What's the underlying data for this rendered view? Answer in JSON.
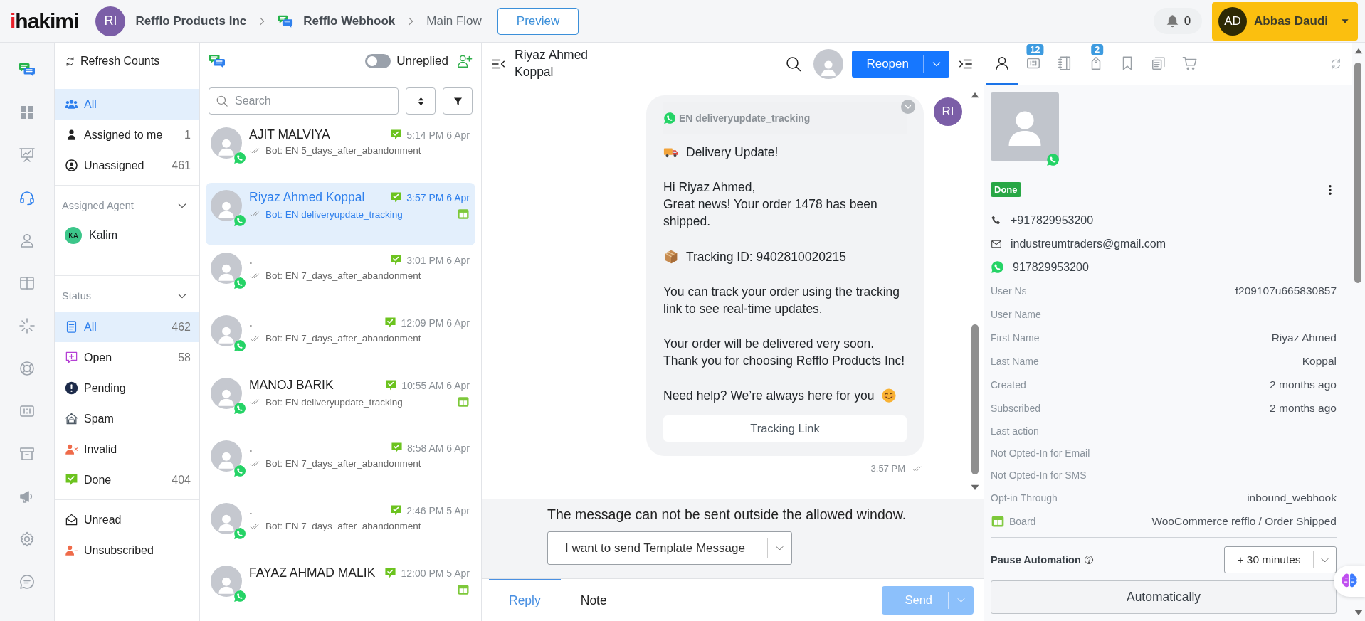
{
  "top_bar": {
    "logo": "ihakimi",
    "workspace": {
      "initials": "RI",
      "name": "Refflo Products Inc"
    },
    "bot": "Refflo Webhook",
    "flow": "Main Flow",
    "preview_button": "Preview",
    "notifications": "0",
    "user": {
      "initials": "AD",
      "name": "Abbas Daudi"
    }
  },
  "rail": [
    {
      "kind": "dashboard",
      "selected": false
    },
    {
      "kind": "analytics",
      "selected": false
    },
    {
      "kind": "inbox",
      "selected": true
    },
    {
      "kind": "contacts",
      "selected": false
    },
    {
      "kind": "columns",
      "selected": false
    },
    {
      "kind": "automation",
      "selected": false
    },
    {
      "kind": "support",
      "selected": false
    },
    {
      "kind": "kanban",
      "selected": false
    },
    {
      "kind": "archive",
      "selected": false
    },
    {
      "kind": "broadcast",
      "selected": false
    },
    {
      "kind": "settings",
      "selected": false
    },
    {
      "kind": "comments",
      "selected": false
    }
  ],
  "filters": {
    "refresh": "Refresh Counts",
    "views": [
      {
        "kind": "all",
        "label": "All",
        "selected": true
      },
      {
        "kind": "me",
        "label": "Assigned to me",
        "count": "1",
        "selected": false
      },
      {
        "kind": "unassigned",
        "label": "Unassigned",
        "count": "461",
        "selected": false
      }
    ],
    "agent_section": {
      "title": "Assigned Agent",
      "expanded": true,
      "agents": [
        {
          "initials": "KA",
          "name": "Kalim"
        }
      ]
    },
    "status_section": {
      "title": "Status",
      "expanded": true,
      "items": [
        {
          "kind": "all",
          "label": "All",
          "count": "462",
          "selected": true
        },
        {
          "kind": "open",
          "label": "Open",
          "count": "58",
          "selected": false
        },
        {
          "kind": "pending",
          "label": "Pending",
          "selected": false
        },
        {
          "kind": "spam",
          "label": "Spam",
          "selected": false
        },
        {
          "kind": "invalid",
          "label": "Invalid",
          "selected": false
        },
        {
          "kind": "done",
          "label": "Done",
          "count": "404",
          "selected": false
        }
      ]
    },
    "extra": [
      {
        "kind": "unread",
        "label": "Unread",
        "selected": false
      },
      {
        "kind": "unsubscribed",
        "label": "Unsubscribed",
        "selected": false
      }
    ]
  },
  "conversation_list": {
    "unreplied": {
      "label": "Unreplied",
      "on": false
    },
    "search": {
      "placeholder": "Search"
    },
    "conversations": [
      {
        "name": "AJIT MALVIYA",
        "time": "5:14 PM 6 Apr",
        "preview": "Bot: EN 5_days_after_abandonment",
        "selected": false,
        "board": false
      },
      {
        "name": "Riyaz Ahmed Koppal",
        "time": "3:57 PM 6 Apr",
        "preview": "Bot: EN deliveryupdate_tracking",
        "selected": true,
        "board": true
      },
      {
        "name": ".",
        "time": "3:01 PM 6 Apr",
        "preview": "Bot: EN 7_days_after_abandonment",
        "selected": false,
        "board": false
      },
      {
        "name": ".",
        "time": "12:09 PM 6 Apr",
        "preview": "Bot: EN 7_days_after_abandonment",
        "selected": false,
        "board": false
      },
      {
        "name": "MANOJ BARIK",
        "time": "10:55 AM 6 Apr",
        "preview": "Bot: EN deliveryupdate_tracking",
        "selected": false,
        "board": true
      },
      {
        "name": ".",
        "time": "8:58 AM 6 Apr",
        "preview": "Bot: EN 7_days_after_abandonment",
        "selected": false,
        "board": false
      },
      {
        "name": ".",
        "time": "2:46 PM 5 Apr",
        "preview": "Bot: EN 7_days_after_abandonment",
        "selected": false,
        "board": false
      },
      {
        "name": "FAYAZ AHMAD MALIK",
        "time": "12:00 PM 5 Apr",
        "selected": false,
        "board": true
      }
    ]
  },
  "chat": {
    "contact_name": "Riyaz Ahmed Koppal",
    "reopen_button": "Reopen",
    "message": {
      "template": "EN deliveryupdate_tracking",
      "avatar": "RI",
      "time": "3:57 PM",
      "paragraphs": [
        {
          "text": "Delivery Update!"
        },
        {
          "text": "Hi Riyaz Ahmed,\nGreat news! Your order 1478 has been shipped."
        },
        {
          "text": "Tracking ID: 9402810020215"
        },
        {
          "text": "You can track your order using the tracking link to see real-time updates."
        },
        {
          "text": "Your order will be delivered very soon.\nThank you for choosing Refflo Products Inc!"
        },
        {
          "text": "Need help? We’re always here for you"
        }
      ],
      "button": "Tracking Link"
    },
    "notice": "The message can not be sent outside the allowed window.",
    "template_select": "I want to send Template Message",
    "tabs": [
      {
        "label": "Reply",
        "selected": true
      },
      {
        "label": "Note",
        "selected": false
      }
    ],
    "send_button": {
      "label": "Send",
      "disabled": true
    }
  },
  "contact_panel": {
    "tabs": [
      {
        "kind": "profile",
        "selected": true
      },
      {
        "kind": "kanban",
        "badge": "12",
        "selected": false
      },
      {
        "kind": "notebook",
        "selected": false
      },
      {
        "kind": "tag",
        "badge": "2",
        "selected": false
      },
      {
        "kind": "bookmark",
        "selected": false
      },
      {
        "kind": "documents",
        "selected": false
      },
      {
        "kind": "cart",
        "selected": false
      }
    ],
    "status": "Done",
    "phone": "+917829953200",
    "email": "industreumtraders@gmail.com",
    "whatsapp": "917829953200",
    "fields": [
      {
        "label": "User Ns",
        "value": "f209107u665830857"
      },
      {
        "label": "User Name"
      },
      {
        "label": "First Name",
        "value": "Riyaz Ahmed"
      },
      {
        "label": "Last Name",
        "value": "Koppal"
      },
      {
        "label": "Created",
        "value": "2 months ago"
      },
      {
        "label": "Subscribed",
        "value": "2 months ago"
      },
      {
        "label": "Last action"
      },
      {
        "label": "Not Opted-In for Email"
      },
      {
        "label": "Not Opted-In for SMS"
      },
      {
        "label": "Opt-in Through",
        "value": "inbound_webhook"
      }
    ],
    "board": {
      "label": "Board",
      "value": "WooCommerce refflo / Order Shipped"
    },
    "pause_label": "Pause Automation",
    "pause_select": "+ 30 minutes",
    "automatically_button": "Automatically"
  }
}
